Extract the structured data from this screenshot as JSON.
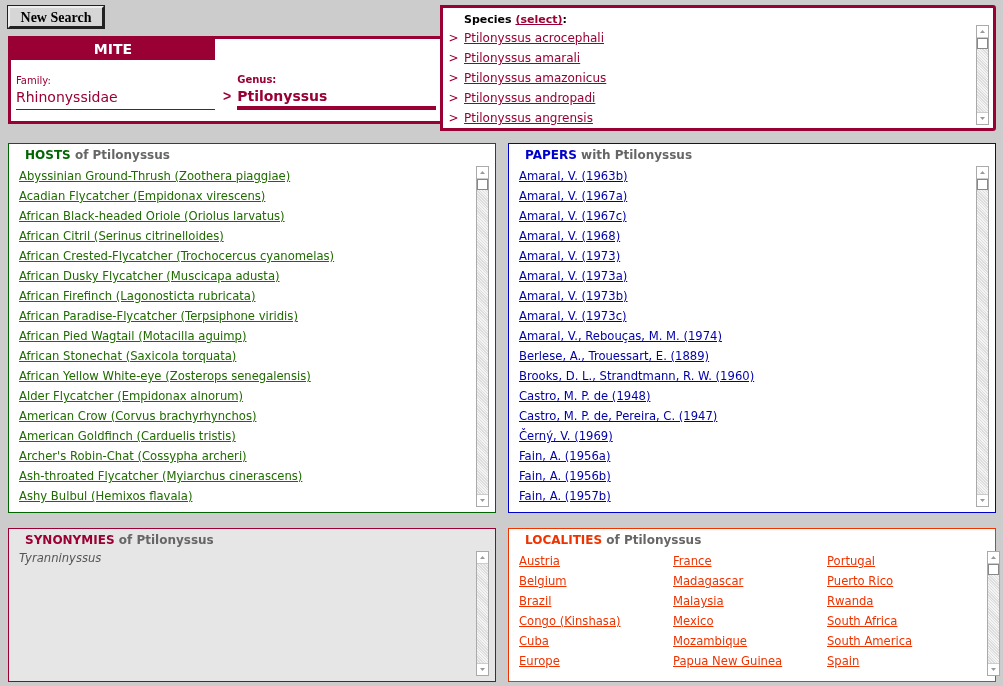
{
  "new_search_button": "New Search",
  "mite": {
    "title": "MITE",
    "family_label": "Family:",
    "family": "Rhinonyssidae",
    "arrow": ">",
    "genus_label": "Genus:",
    "genus": "Ptilonyssus"
  },
  "species": {
    "label": "Species",
    "action": "(select)",
    "suffix": ":",
    "items": [
      {
        "marker": ">",
        "name": "Ptilonyssus acrocephali"
      },
      {
        "marker": ">",
        "name": "Ptilonyssus amarali"
      },
      {
        "marker": ">",
        "name": "Ptilonyssus amazonicus"
      },
      {
        "marker": ">",
        "name": "Ptilonyssus andropadi"
      },
      {
        "marker": ">",
        "name": "Ptilonyssus angrensis"
      }
    ]
  },
  "panels": [
    {
      "kind": "hosts",
      "title": "HOSTS",
      "subtitle": "of Ptilonyssus",
      "color": "#006600",
      "items": [
        "Abyssinian Ground-Thrush (Zoothera piaggiae)",
        "Acadian Flycatcher (Empidonax virescens)",
        "African Black-headed Oriole (Oriolus larvatus)",
        "African Citril (Serinus citrinelloides)",
        "African Crested-Flycatcher (Trochocercus cyanomelas)",
        "African Dusky Flycatcher (Muscicapa adusta)",
        "African Firefinch (Lagonosticta rubricata)",
        "African Paradise-Flycatcher (Terpsiphone viridis)",
        "African Pied Wagtail (Motacilla aguimp)",
        "African Stonechat (Saxicola torquata)",
        "African Yellow White-eye (Zosterops senegalensis)",
        "Alder Flycatcher (Empidonax alnorum)",
        "American Crow (Corvus brachyrhynchos)",
        "American Goldfinch (Carduelis tristis)",
        "Archer's Robin-Chat (Cossypha archeri)",
        "Ash-throated Flycatcher (Myiarchus cinerascens)",
        "Ashy Bulbul (Hemixos flavala)"
      ]
    },
    {
      "kind": "papers",
      "title": "PAPERS",
      "subtitle": "with Ptilonyssus",
      "color": "#0000cc",
      "items": [
        "Amaral, V. (1963b)",
        "Amaral, V. (1967a)",
        "Amaral, V. (1967c)",
        "Amaral, V. (1968)",
        "Amaral, V. (1973)",
        "Amaral, V. (1973a)",
        "Amaral, V. (1973b)",
        "Amaral, V. (1973c)",
        "Amaral, V., Rebouças, M. M. (1974)",
        "Berlese, A., Trouessart, E. (1889)",
        "Brooks, D. L., Strandtmann, R. W. (1960)",
        "Castro, M. P. de (1948)",
        "Castro, M. P. de, Pereira, C. (1947)",
        "Černý, V. (1969)",
        "Fain, A. (1956a)",
        "Fain, A. (1956b)",
        "Fain, A. (1957b)"
      ]
    },
    {
      "kind": "synonymies",
      "title": "SYNONYMIES",
      "subtitle": "of Ptilonyssus",
      "color": "#990033",
      "items": [
        "Tyranninyssus"
      ]
    },
    {
      "kind": "localities",
      "title": "LOCALITIES",
      "subtitle": "of Ptilonyssus",
      "color": "#ee3300",
      "items": [
        "Austria",
        "Belgium",
        "Brazil",
        "Congo (Kinshasa)",
        "Cuba",
        "Europe",
        "France",
        "Madagascar",
        "Malaysia",
        "Mexico",
        "Mozambique",
        "Papua New Guinea",
        "Portugal",
        "Puerto Rico",
        "Rwanda",
        "South Africa",
        "South America",
        "Spain"
      ]
    }
  ]
}
